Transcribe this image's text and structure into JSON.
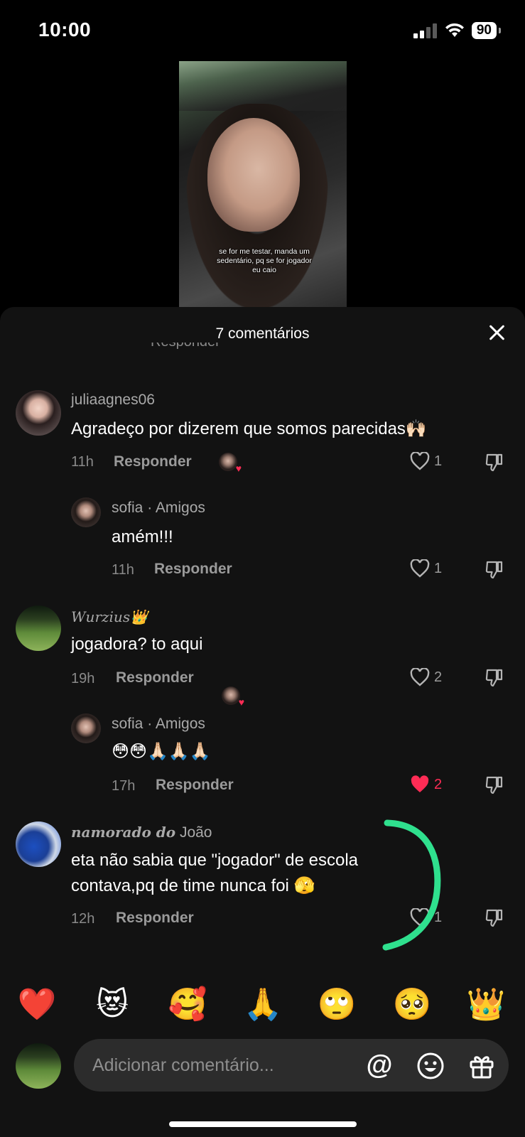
{
  "status_bar": {
    "time": "10:00",
    "battery": "90"
  },
  "video": {
    "caption": "se for me testar, manda um sedentário, pq se for jogador eu caio"
  },
  "sheet": {
    "title": "7 comentários",
    "clipped_meta": "Responder"
  },
  "comments": [
    {
      "username": "juliaagnes06",
      "text": "Agradeço por dizerem que somos parecidas🙌🏻",
      "time": "11h",
      "reply": "Responder",
      "likes": "1",
      "liked": false
    },
    {
      "username": "sofia · Amigos",
      "text": "amém!!!",
      "time": "11h",
      "reply": "Responder",
      "likes": "1",
      "liked": false
    },
    {
      "username": "𝑊𝑢𝑟𝑧𝑖𝑢𝑠👑",
      "text": "jogadora? to aqui",
      "time": "19h",
      "reply": "Responder",
      "likes": "2",
      "liked": false
    },
    {
      "username": "sofia · Amigos",
      "text": "😳😳🙏🏻🙏🏻🙏🏻",
      "time": "17h",
      "reply": "Responder",
      "likes": "2",
      "liked": true
    },
    {
      "username_styled": "namorado do",
      "username_plain": " João",
      "text_line1": "eta não sabia que \"jogador\" de escola",
      "text_line2": "contava,pq de time nunca foi 🫣",
      "time": "12h",
      "reply": "Responder",
      "likes": "1",
      "liked": false
    }
  ],
  "emoji_bar": [
    "❤️",
    "😻",
    "🥰",
    "🙏",
    "🙄",
    "🥺",
    "👑"
  ],
  "input": {
    "placeholder": "Adicionar comentário...",
    "at_icon": "@"
  },
  "colors": {
    "like_red": "#fe2c55",
    "annotation_green": "#2fe08e",
    "sheet_bg": "#121212"
  }
}
